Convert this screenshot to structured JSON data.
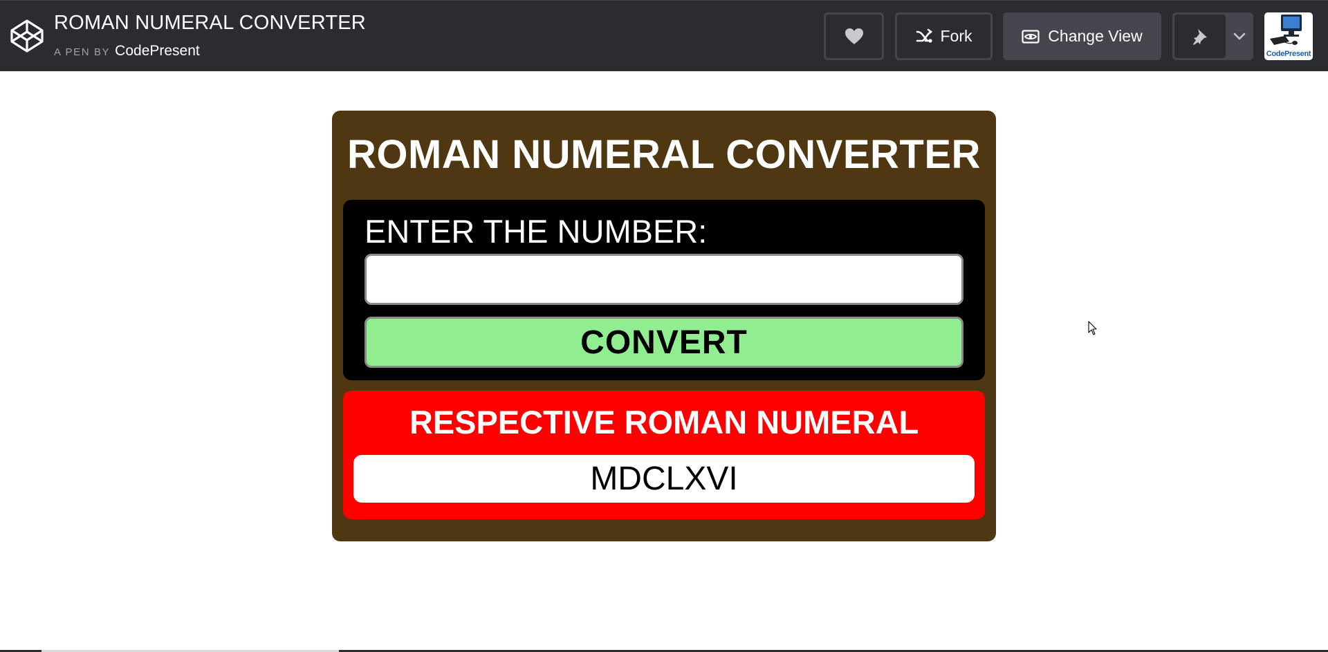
{
  "header": {
    "title": "ROMAN NUMERAL CONVERTER",
    "by_prefix": "A PEN BY",
    "author": "CodePresent",
    "like_icon": "heart-icon",
    "fork_label": "Fork",
    "fork_icon": "fork-icon",
    "change_view_label": "Change View",
    "change_view_icon": "eye-icon",
    "pin_icon": "pin-icon",
    "menu_icon": "chevron-down-icon",
    "avatar_caption": "CodePresent"
  },
  "app": {
    "title": "ROMAN NUMERAL CONVERTER",
    "input_label": "ENTER THE NUMBER:",
    "input_value": "",
    "convert_label": "CONVERT",
    "result_title": "RESPECTIVE ROMAN NUMERAL",
    "result_value": "MDCLXVI"
  },
  "colors": {
    "header_bg": "#2b2c32",
    "card_bg": "#4f3711",
    "input_panel_bg": "#000000",
    "convert_button_bg": "#90ee90",
    "result_panel_bg": "#ff0000",
    "text_white": "#ffffff"
  }
}
